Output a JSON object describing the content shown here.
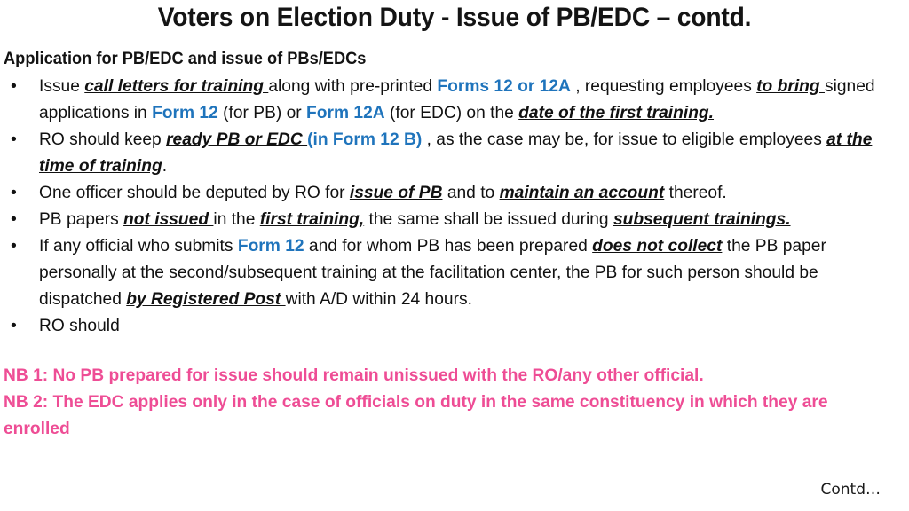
{
  "slide": {
    "title": "Voters on Election Duty - Issue of PB/EDC – contd.",
    "subheading": "Application for PB/EDC and issue of PBs/EDCs",
    "bullet_glyph": "•",
    "footer_note": "Contd…"
  },
  "colors": {
    "background": "#ffffff",
    "text": "#111111",
    "accent_blue": "#1F74BC",
    "accent_pink": "#EE4D95"
  },
  "bullets": [
    {
      "id": "bullet-issue-call-letters",
      "plain_text": "Issue call letters for training along with pre-printed Forms 12 or 12A , requesting employees to bring signed applications in Form 12 (for PB) or Form 12A (for EDC) on the date of the first training.",
      "runs": [
        {
          "t": "Issue ",
          "s": "plain"
        },
        {
          "t": "call letters for training ",
          "s": "biu"
        },
        {
          "t": "along with pre-printed ",
          "s": "plain"
        },
        {
          "t": "Forms 12 or 12A",
          "s": "blue"
        },
        {
          "t": " , requesting employees ",
          "s": "plain"
        },
        {
          "t": "to bring ",
          "s": "biu"
        },
        {
          "t": "signed applications in ",
          "s": "plain"
        },
        {
          "t": "Form 12",
          "s": "blue"
        },
        {
          "t": " (for PB) or ",
          "s": "plain"
        },
        {
          "t": "Form 12A",
          "s": "blue"
        },
        {
          "t": " (for EDC) on the ",
          "s": "plain"
        },
        {
          "t": "date of the first training.",
          "s": "biu"
        }
      ]
    },
    {
      "id": "bullet-ro-keep-ready",
      "plain_text": "RO should keep ready PB or EDC (in Form 12 B) , as the case may be, for issue to eligible employees at the time of training.",
      "runs": [
        {
          "t": "RO should keep ",
          "s": "plain"
        },
        {
          "t": "ready PB or EDC ",
          "s": "biu"
        },
        {
          "t": "(in Form 12 B)",
          "s": "blue"
        },
        {
          "t": " , as the case may be, for issue to eligible employees ",
          "s": "plain"
        },
        {
          "t": "at the time of training",
          "s": "biu"
        },
        {
          "t": ".",
          "s": "plain"
        }
      ]
    },
    {
      "id": "bullet-one-officer-deputed",
      "plain_text": "One officer should be deputed by RO for issue of PB and to maintain an account thereof.",
      "runs": [
        {
          "t": "One officer should be deputed by RO for ",
          "s": "plain"
        },
        {
          "t": "issue of PB",
          "s": "biu"
        },
        {
          "t": " and to ",
          "s": "plain"
        },
        {
          "t": "maintain an account",
          "s": "biu"
        },
        {
          "t": " thereof.",
          "s": "plain"
        }
      ]
    },
    {
      "id": "bullet-pb-papers-not-issued",
      "plain_text": " PB papers not issued in the first training, the same shall be issued during subsequent trainings.",
      "runs": [
        {
          "t": " PB papers ",
          "s": "plain"
        },
        {
          "t": "not issued ",
          "s": "biu"
        },
        {
          "t": "in the ",
          "s": "plain"
        },
        {
          "t": "first training,",
          "s": "biu"
        },
        {
          "t": " the same shall be issued during ",
          "s": "plain"
        },
        {
          "t": "subsequent trainings.",
          "s": "biu"
        }
      ]
    },
    {
      "id": "bullet-does-not-collect",
      "plain_text": "If any official who submits Form 12 and for whom PB has been prepared does not collect the PB paper personally at the second/subsequent training at the facilitation center, the PB for such person should be dispatched by Registered Post with A/D within 24 hours.",
      "runs": [
        {
          "t": "If any official who submits ",
          "s": "plain"
        },
        {
          "t": "Form 12",
          "s": "blue"
        },
        {
          "t": " and for whom PB has been prepared ",
          "s": "plain"
        },
        {
          "t": "does not collect",
          "s": "biu"
        },
        {
          "t": " the PB paper personally at the second/subsequent training at the facilitation center, the PB for such person should be dispatched ",
          "s": "plain"
        },
        {
          "t": "by Registered Post ",
          "s": "biu"
        },
        {
          "t": "with A/D within 24 hours.",
          "s": "plain"
        }
      ]
    },
    {
      "id": "bullet-ro-should",
      "plain_text": "RO should",
      "runs": [
        {
          "t": "RO should",
          "s": "plain"
        }
      ]
    }
  ],
  "notes": [
    {
      "id": "nb-1",
      "text": "NB 1: No PB prepared for issue should remain unissued with the RO/any other official."
    },
    {
      "id": "nb-2",
      "text": "NB 2: The EDC applies only in the case of officials on duty in the same constituency in which they are enrolled"
    }
  ]
}
